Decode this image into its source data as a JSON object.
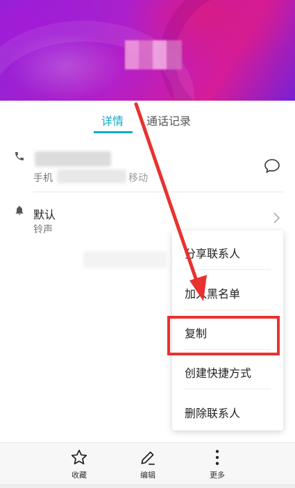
{
  "contact": {
    "tabs": [
      {
        "label": "详情",
        "active": true
      },
      {
        "label": "通话记录",
        "active": false
      }
    ],
    "phone": {
      "type_label": "手机",
      "carrier_suffix": "移动"
    },
    "ringtone": {
      "title": "默认",
      "subtitle": "铃声"
    }
  },
  "context_menu": {
    "items": [
      {
        "label": "分享联系人"
      },
      {
        "label": "加入黑名单"
      },
      {
        "label": "复制"
      },
      {
        "label": "创建快捷方式"
      },
      {
        "label": "删除联系人"
      }
    ],
    "highlighted_item": "复制"
  },
  "bottom_bar": {
    "items": [
      {
        "label": "收藏",
        "icon": "star-icon"
      },
      {
        "label": "编辑",
        "icon": "pencil-icon"
      },
      {
        "label": "更多",
        "icon": "more-vertical-icon"
      }
    ]
  },
  "colors": {
    "accent": "#11a9c4",
    "annotation_red": "#e8322f",
    "header_purple": "#9b22d4",
    "header_magenta": "#d61c98"
  }
}
